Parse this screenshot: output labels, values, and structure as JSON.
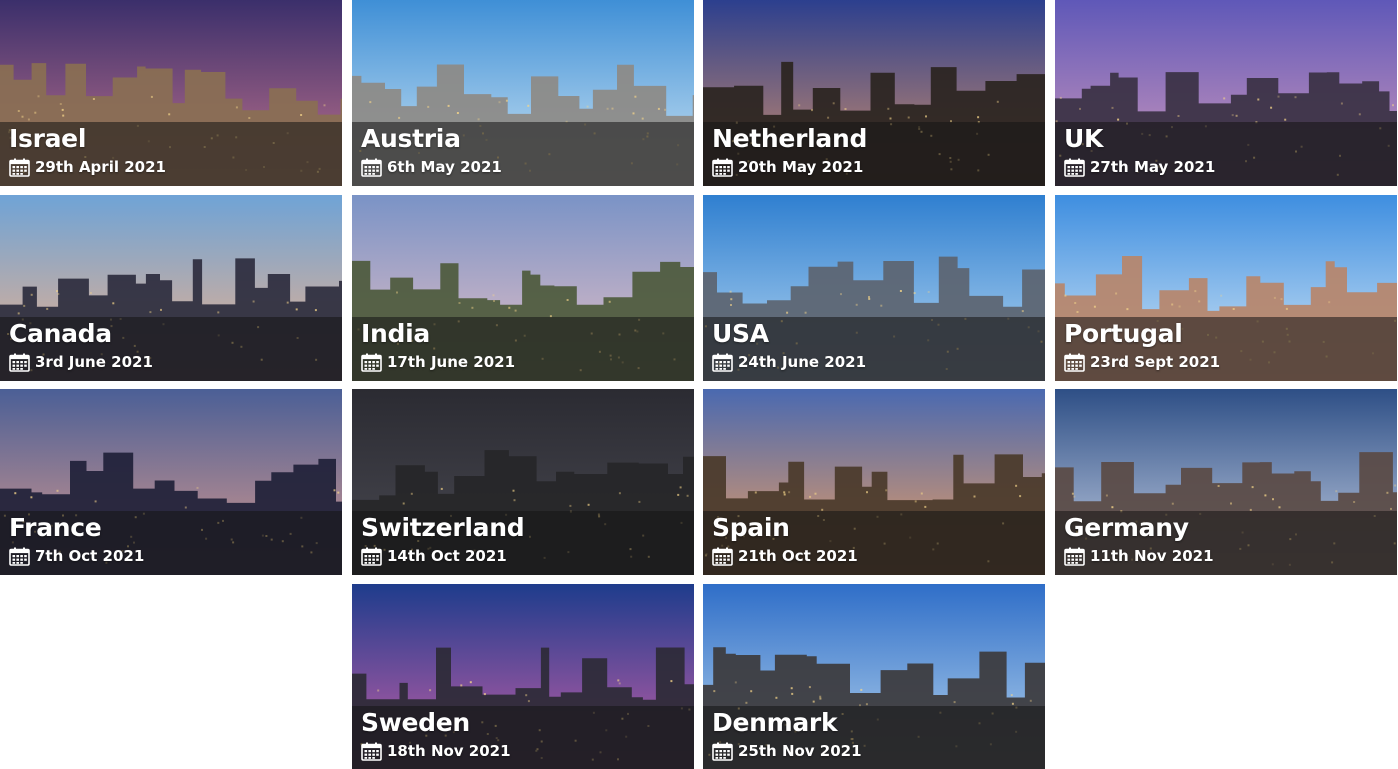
{
  "tours": [
    {
      "country": "Israel",
      "date": "29th April 2021",
      "icon": "calendar-icon",
      "sky": [
        "#3b2f6b",
        "#c3748e"
      ],
      "ground": "#8a6f52"
    },
    {
      "country": "Austria",
      "date": "6th May 2021",
      "icon": "calendar-icon",
      "sky": [
        "#3f8fd6",
        "#cfe6f4"
      ],
      "ground": "#8d8a86"
    },
    {
      "country": "Netherland",
      "date": "20th May 2021",
      "icon": "calendar-icon",
      "sky": [
        "#2c3f8e",
        "#d08f6b"
      ],
      "ground": "#2a2420"
    },
    {
      "country": "UK",
      "date": "27th May 2021",
      "icon": "calendar-icon",
      "sky": [
        "#5f58b8",
        "#d39bbd"
      ],
      "ground": "#3a3143"
    },
    {
      "country": "Canada",
      "date": "3rd June 2021",
      "icon": "calendar-icon",
      "sky": [
        "#6fa3d6",
        "#f0b28a"
      ],
      "ground": "#2c2c3e"
    },
    {
      "country": "India",
      "date": "17th June 2021",
      "icon": "calendar-icon",
      "sky": [
        "#7a93c6",
        "#e7c0c6"
      ],
      "ground": "#4d5a3c"
    },
    {
      "country": "USA",
      "date": "24th June 2021",
      "icon": "calendar-icon",
      "sky": [
        "#2f7fd0",
        "#b9d9f2"
      ],
      "ground": "#5c6470"
    },
    {
      "country": "Portugal",
      "date": "23rd Sept 2021",
      "icon": "calendar-icon",
      "sky": [
        "#3e8ee0",
        "#d5e8f6"
      ],
      "ground": "#b7856a"
    },
    {
      "country": "France",
      "date": "7th Oct 2021",
      "icon": "calendar-icon",
      "sky": [
        "#4b5f96",
        "#d89a8e"
      ],
      "ground": "#1f2138"
    },
    {
      "country": "Switzerland",
      "date": "14th Oct 2021",
      "icon": "calendar-icon",
      "sky": [
        "#2b2b32",
        "#4a4a52"
      ],
      "ground": "#262628"
    },
    {
      "country": "Spain",
      "date": "21th Oct 2021",
      "icon": "calendar-icon",
      "sky": [
        "#4a69b0",
        "#f0a060"
      ],
      "ground": "#4a3a2a"
    },
    {
      "country": "Germany",
      "date": "11th Nov 2021",
      "icon": "calendar-icon",
      "sky": [
        "#2e4f86",
        "#c9d3e6"
      ],
      "ground": "#5a4a44"
    },
    {
      "country": "Sweden",
      "date": "18th Nov 2021",
      "icon": "calendar-icon",
      "sky": [
        "#1e3c8c",
        "#c860a8"
      ],
      "ground": "#2c2a36"
    },
    {
      "country": "Denmark",
      "date": "25th Nov 2021",
      "icon": "calendar-icon",
      "sky": [
        "#2f6ec8",
        "#b8d6ee"
      ],
      "ground": "#3c3a3c"
    }
  ]
}
